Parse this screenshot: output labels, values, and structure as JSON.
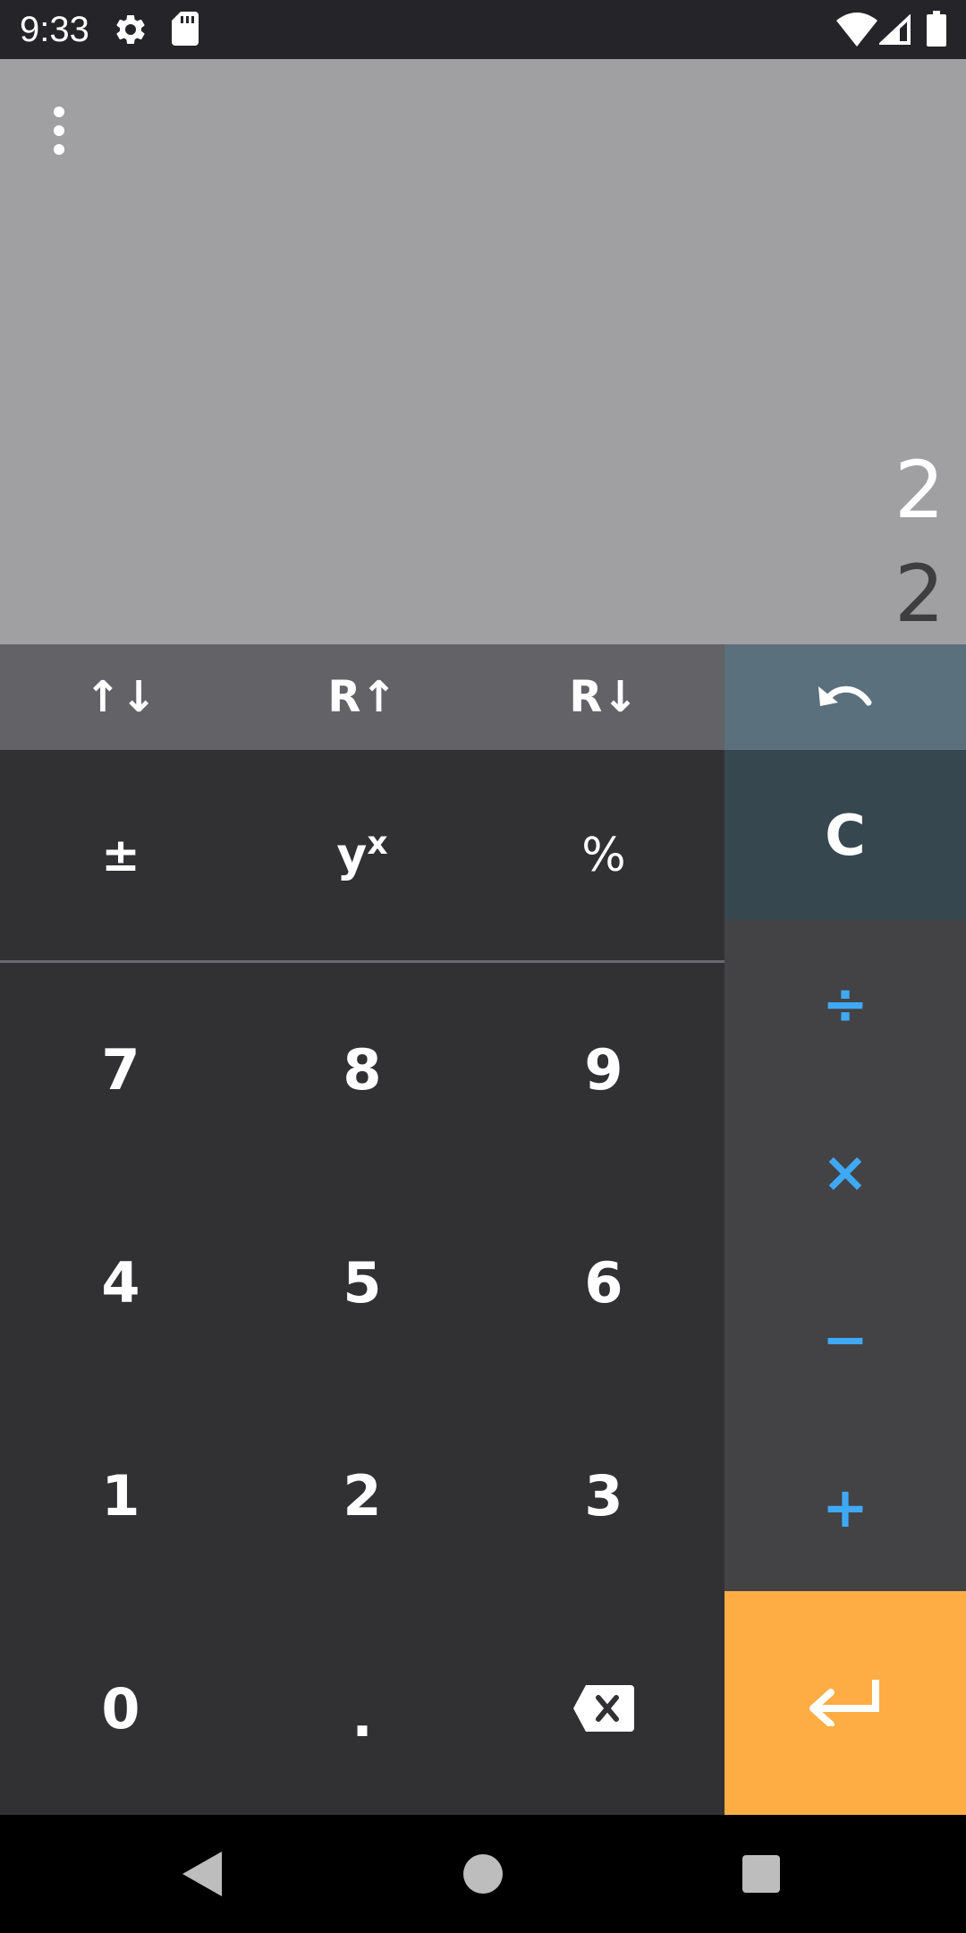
{
  "status_bar": {
    "time": "9:33",
    "icons": [
      "gear-icon",
      "sd-card-icon",
      "wifi-icon",
      "signal-icon",
      "battery-icon"
    ]
  },
  "display": {
    "menu_icon": "more-vert-icon",
    "stack_y": "2",
    "stack_x": "2"
  },
  "stack_row": {
    "swap": "↑↓",
    "roll_up": "R↑",
    "roll_down": "R↓",
    "undo_icon": "undo-icon"
  },
  "function_row": {
    "negate": "±",
    "power_base": "y",
    "power_exp": "x",
    "percent": "%"
  },
  "clear": "C",
  "numpad": {
    "k7": "7",
    "k8": "8",
    "k9": "9",
    "k4": "4",
    "k5": "5",
    "k6": "6",
    "k1": "1",
    "k2": "2",
    "k3": "3",
    "k0": "0",
    "decimal": ".",
    "backspace_icon": "backspace-icon"
  },
  "operators": {
    "divide": "÷",
    "multiply": "×",
    "subtract": "−",
    "add": "+"
  },
  "enter_icon": "enter-icon",
  "colors": {
    "display_bg": "#a09fa2",
    "keypad_bg": "#313033",
    "stack_row_bg": "#636266",
    "ops_bg": "#434245",
    "operator_text": "#3fa9f5",
    "enter_bg": "#fdad43",
    "undo_bg": "#5a707d",
    "clear_bg": "#37474f"
  },
  "nav_bar": {
    "back_icon": "back-icon",
    "home_icon": "home-icon",
    "recents_icon": "recents-icon"
  }
}
